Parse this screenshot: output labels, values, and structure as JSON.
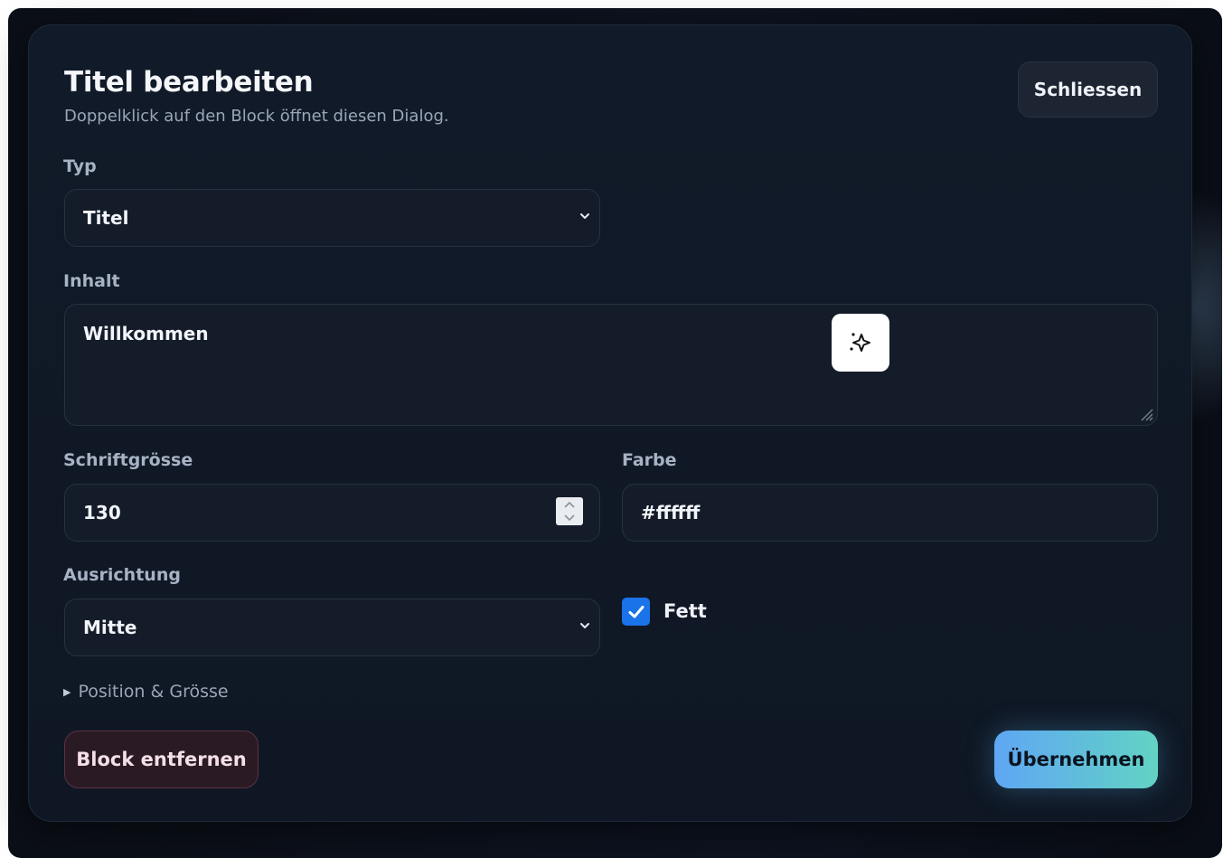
{
  "dialog": {
    "title": "Titel bearbeiten",
    "subtitle": "Doppelklick auf den Block öffnet diesen Dialog.",
    "close_label": "Schliessen"
  },
  "fields": {
    "type": {
      "label": "Typ",
      "value": "Titel"
    },
    "content": {
      "label": "Inhalt",
      "value": "Willkommen"
    },
    "font_size": {
      "label": "Schriftgrösse",
      "value": "130"
    },
    "color": {
      "label": "Farbe",
      "value": "#ffffff"
    },
    "alignment": {
      "label": "Ausrichtung",
      "value": "Mitte"
    },
    "bold": {
      "label": "Fett",
      "checked": true
    }
  },
  "position_section": {
    "label": "Position & Grösse"
  },
  "actions": {
    "remove_label": "Block entfernen",
    "apply_label": "Übernehmen"
  },
  "icons": {
    "ai_assist": "sparkle-icon",
    "select_arrow": "chevron-down-icon",
    "checkbox": "check-icon"
  },
  "colors": {
    "accent": "#1a73e8",
    "apply_gradient_start": "#5fa6f4",
    "apply_gradient_end": "#62d3c4",
    "danger_bg": "#2a1a24"
  }
}
